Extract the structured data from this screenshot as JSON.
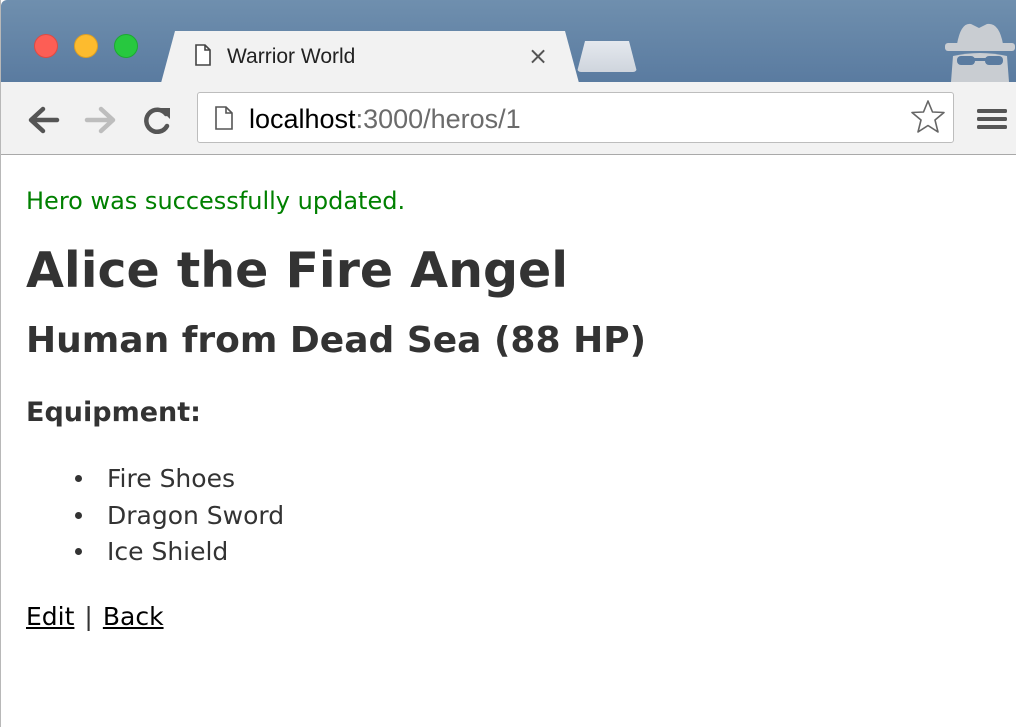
{
  "browser": {
    "tab_title": "Warrior World",
    "tab_close": "×",
    "url_host": "localhost",
    "url_rest": ":3000/heros/1"
  },
  "page": {
    "notice": "Hero was successfully updated.",
    "hero_name": "Alice the Fire Angel",
    "hero_subtitle": "Human from Dead Sea (88 HP)",
    "equipment_heading": "Equipment:",
    "equipment": [
      "Fire Shoes",
      "Dragon Sword",
      "Ice Shield"
    ],
    "edit_link": "Edit",
    "separator": "|",
    "back_link": "Back"
  },
  "colors": {
    "notice": "#008000",
    "text": "#333333",
    "titlebar": "#5a7ba0"
  },
  "icons": {
    "tab": "page-icon",
    "back": "arrow-left-icon",
    "forward": "arrow-right-icon",
    "reload": "reload-icon",
    "url": "page-icon",
    "bookmark": "star-icon",
    "menu": "hamburger-menu-icon",
    "profile": "incognito-icon"
  }
}
